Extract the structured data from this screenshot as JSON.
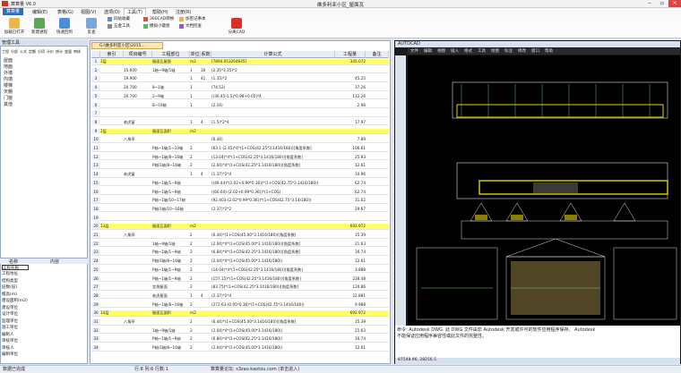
{
  "app": {
    "title": "算算量 V6.0",
    "window_title": "维多利亚小区_屋面瓦"
  },
  "menu": [
    "算算量",
    "编辑(E)",
    "表格(G)",
    "视图(V)",
    "选项(O)",
    "工具(T)",
    "帮助(H)",
    "注册(R)"
  ],
  "ribbon": {
    "btn1": "加载已打开",
    "btn2": "新建进程",
    "btn3": "快速回到",
    "btn4": "反查",
    "small": [
      "同站收藏",
      "360CAD转换",
      "加密记事本",
      "五金工具",
      "模拟小键盘",
      "文档检查"
    ],
    "btn_split": "分离CAD"
  },
  "left_panel": {
    "title": "管理工具",
    "tabs": [
      "工程",
      "分部",
      "公式",
      "定额",
      "分项",
      "计价",
      "统计",
      "变量",
      "审核"
    ],
    "tree": [
      "屋面",
      "地面",
      "外墙",
      "内墙",
      "楼梯",
      "天棚",
      "门窗",
      "其他"
    ],
    "prop_headers": [
      "名称",
      "内容"
    ],
    "props": [
      "工程名称",
      "工程地址",
      "结构类型",
      "层数(层)",
      "檐高(m)",
      "建设面积(m2)",
      "建设单位",
      "设计单位",
      "监理单位",
      "施工单位",
      "编制人",
      "审核单位",
      "审核人",
      "编制单位"
    ]
  },
  "grid_tab": "G:\\维多利亚小区\\2015...",
  "grid": {
    "headers": [
      "",
      "索引",
      "项目编号",
      "工程部位",
      "单位",
      "系数",
      "计算公式",
      "工程量",
      "备注"
    ],
    "rows": [
      {
        "no": "1",
        "idx": "1层",
        "code": "",
        "part": "屋面瓦屋面",
        "unit": "m2",
        "coef": "",
        "formula": "[7894.053264645]",
        "qty": "345.072",
        "y": true
      },
      {
        "no": "2",
        "idx": "",
        "code": "15.600",
        "part": "1轴~9轴/1轴",
        "unit": "1",
        "coef": "30",
        "formula": "(2.35*3.35)*2",
        "qty": "",
        "y": false
      },
      {
        "no": "3",
        "idx": "",
        "code": "19.900",
        "part": "",
        "unit": "1",
        "coef": "41",
        "formula": "(1.35)*2",
        "qty": "45.25",
        "y": false
      },
      {
        "no": "4",
        "idx": "",
        "code": "20.700",
        "part": "8~1轴",
        "unit": "1",
        "coef": "",
        "formula": "(74.52)",
        "qty": "37.26",
        "y": false
      },
      {
        "no": "5",
        "idx": "",
        "code": "20.700",
        "part": "2~9轴",
        "unit": "1",
        "coef": "",
        "formula": "((30.45-1.5)*0.98+0.05)*4",
        "qty": "112.26",
        "y": false
      },
      {
        "no": "6",
        "idx": "",
        "code": "",
        "part": "8~10轴",
        "unit": "1",
        "coef": "",
        "formula": "(2.16)",
        "qty": "2.96",
        "y": false
      },
      {
        "no": "7",
        "idx": "",
        "code": "",
        "part": "",
        "unit": "",
        "coef": "",
        "formula": "",
        "qty": "",
        "y": false
      },
      {
        "no": "8",
        "idx": "",
        "code": "老虎窗",
        "part": "",
        "unit": "1",
        "coef": "4",
        "formula": "(1.5)*2*4",
        "qty": "17.97",
        "y": false
      },
      {
        "no": "9",
        "idx": "2层",
        "code": "",
        "part": "屋面瓦面积",
        "unit": "m2",
        "coef": "",
        "formula": "",
        "qty": "",
        "y": true
      },
      {
        "no": "10",
        "idx": "",
        "code": "八角亭",
        "part": "",
        "unit": "",
        "coef": "",
        "formula": "(6.44)",
        "qty": "7.89",
        "y": false
      },
      {
        "no": "11",
        "idx": "",
        "code": "",
        "part": "P轴~1轴/1~10轴",
        "unit": "2",
        "coef": "",
        "formula": "(63.1-(2.45)*4*(1+COS(42.25*3.1416/180))[角度系数]",
        "qty": "106.61",
        "y": false
      },
      {
        "no": "12",
        "idx": "",
        "code": "",
        "part": "P轴~1轴/8~16轴",
        "unit": "2",
        "coef": "",
        "formula": "(13.04)*4*(1+COS(42.25*3.1416/180))[角度系数]",
        "qty": "25.93",
        "y": false
      },
      {
        "no": "13",
        "idx": "",
        "code": "",
        "part": "P轴/1轴/8~16轴",
        "unit": "2",
        "coef": "",
        "formula": "(2.04)*4*(1+COS(42.25*3.1416/180))[角度系数]",
        "qty": "12.61",
        "y": false
      },
      {
        "no": "14",
        "idx": "",
        "code": "老虎窗",
        "part": "",
        "unit": "1",
        "coef": "4",
        "formula": "(1.37)*2*4",
        "qty": "10.96",
        "y": false
      },
      {
        "no": "15",
        "idx": "",
        "code": "",
        "part": "P轴~1轴/1~9轴",
        "unit": "",
        "coef": "",
        "formula": "((49.44)*(2.02+0.99*0.36))*(1+COS(42.75*3.1416/180))",
        "qty": "62.74",
        "y": false
      },
      {
        "no": "16",
        "idx": "",
        "code": "",
        "part": "P轴~1轴/1~9轴",
        "unit": "",
        "coef": "",
        "formula": "((60.64)-(2.02+0.99*0.36))*(1+COS)",
        "qty": "62.74",
        "y": false
      },
      {
        "no": "17",
        "idx": "",
        "code": "",
        "part": "P轴~1轴/10~17轴",
        "unit": "",
        "coef": "",
        "formula": "(92.403-(2.02*0.99*0.36))*(1+COS(42.75*3.14/180))",
        "qty": "31.62",
        "y": false
      },
      {
        "no": "18",
        "idx": "",
        "code": "",
        "part": "P轴/1轴/10~16轴",
        "unit": "",
        "coef": "",
        "formula": "(2.37)*2*2",
        "qty": "29.67",
        "y": false
      },
      {
        "no": "19",
        "idx": "",
        "code": "",
        "part": "",
        "unit": "",
        "coef": "",
        "formula": "",
        "qty": "",
        "y": false
      },
      {
        "no": "20",
        "idx": "13层",
        "code": "",
        "part": "屋面瓦面积",
        "unit": "m2",
        "coef": "",
        "formula": "",
        "qty": "692.972",
        "y": true
      },
      {
        "no": "21",
        "idx": "",
        "code": "八角亭",
        "part": "",
        "unit": "2",
        "coef": "",
        "formula": "(6.44)*(1+COS(45.00*3.1416/180))[角度系数]",
        "qty": "15.39",
        "y": false
      },
      {
        "no": "22",
        "idx": "",
        "code": "",
        "part": "1轴~9轴/1轴",
        "unit": "2",
        "coef": "",
        "formula": "(2.04)*4*(1+COS(45.00*3.1416/180))[角度系数]",
        "qty": "21.63",
        "y": false
      },
      {
        "no": "23",
        "idx": "",
        "code": "",
        "part": "P轴~1轴/1~9轴",
        "unit": "2",
        "coef": "",
        "formula": "(6.84)*4*(1+COS(42.25*3.1416/180))[角度系数]",
        "qty": "16.74",
        "y": false
      },
      {
        "no": "24",
        "idx": "",
        "code": "",
        "part": "P轴/1轴/8~16轴",
        "unit": "2",
        "coef": "",
        "formula": "(2.04)*4*(1+COS(45.00*3.1416/180))",
        "qty": "12.61",
        "y": false
      },
      {
        "no": "25",
        "idx": "",
        "code": "",
        "part": "P轴~1轴/1~9轴",
        "unit": "2",
        "coef": "",
        "formula": "(14.04)*4*(1+COS(42.25*3.1416/180))[角度系数]",
        "qty": "3.888",
        "y": false
      },
      {
        "no": "26",
        "idx": "",
        "code": "",
        "part": "P轴~1轴/1~9轴",
        "unit": "2",
        "coef": "",
        "formula": "(157.15)*(1+COS(42.25*3.1416/180))[角度系数]",
        "qty": "238.48",
        "y": false
      },
      {
        "no": "27",
        "idx": "",
        "code": "",
        "part": "北侧屋面",
        "unit": "2",
        "coef": "",
        "formula": "(83.75)*(1+COS(42.25*3.1416/180))[角度系数]",
        "qty": "120.86",
        "y": false
      },
      {
        "no": "28",
        "idx": "",
        "code": "",
        "part": "老虎屋面",
        "unit": "1",
        "coef": "4",
        "formula": "(2.37)*2*4",
        "qty": "22.881",
        "y": false
      },
      {
        "no": "29",
        "idx": "",
        "code": "",
        "part": "P轴~1轴/8~16轴",
        "unit": "2",
        "coef": "",
        "formula": "(272.63-(0.95*0.36)*(1+COS(42.75*3.1416/180))",
        "qty": "9.988",
        "y": false
      },
      {
        "no": "30",
        "idx": "14层",
        "code": "",
        "part": "屋面瓦面积",
        "unit": "m2",
        "coef": "",
        "formula": "",
        "qty": "692.972",
        "y": true
      },
      {
        "no": "31",
        "idx": "",
        "code": "八角亭",
        "part": "",
        "unit": "2",
        "coef": "",
        "formula": "(6.44)*(1+COS(45.00*3.1416/180))[角度系数]",
        "qty": "15.39",
        "y": false
      },
      {
        "no": "32",
        "idx": "",
        "code": "",
        "part": "1轴~9轴/1轴",
        "unit": "2",
        "coef": "",
        "formula": "(2.04)*4*(1+COS(45.00*3.1416/180))",
        "qty": "21.63",
        "y": false
      },
      {
        "no": "33",
        "idx": "",
        "code": "",
        "part": "P轴~1轴/1~9轴",
        "unit": "2",
        "coef": "",
        "formula": "(6.84)*4*(1+COS(42.25*3.1416/180))",
        "qty": "16.74",
        "y": false
      },
      {
        "no": "34",
        "idx": "",
        "code": "",
        "part": "P轴/1轴/8~16轴",
        "unit": "2",
        "coef": "",
        "formula": "(2.04)*4*(1+COS(45.00*3.1416/180))",
        "qty": "12.61",
        "y": false
      }
    ]
  },
  "cad": {
    "title": "AUTOCAD",
    "menu": [
      "文件",
      "编辑",
      "视图",
      "插入",
      "格式",
      "工具",
      "绘图",
      "标注",
      "修改",
      "窗口",
      "帮助"
    ],
    "cmd1": "命令: Autodesk DWG. 此 DWG 文件由非 Autodesk 开发或许可的软件应用程序保存。 Autodesk",
    "cmd2": "不能保证应用程序兼容性或此文件的完整性。",
    "coords": "87548.96, 28256.5"
  },
  "status": {
    "left": "数据已完成",
    "mid": "行:8 列:6 行数:1",
    "web": "算算量论坛: s3zao.kaotou.com (单击进入)"
  }
}
